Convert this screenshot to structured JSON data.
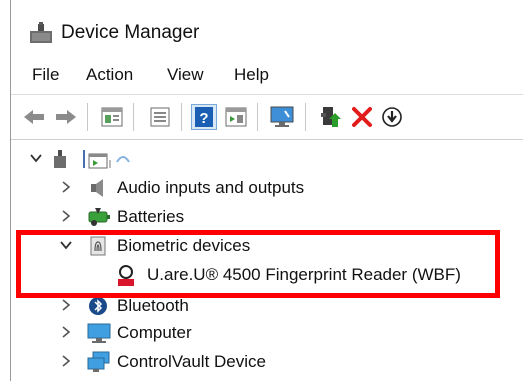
{
  "window": {
    "title": "Device Manager"
  },
  "menu": {
    "items": [
      "File",
      "Action",
      "View",
      "Help"
    ]
  },
  "toolbar": {
    "icons": [
      "back-arrow-icon",
      "forward-arrow-icon",
      "properties-pane-icon",
      "list-view-icon",
      "help-icon",
      "driver-details-icon",
      "scan-monitor-icon",
      "update-driver-icon",
      "uninstall-icon",
      "download-icon"
    ]
  },
  "tree": {
    "root": {
      "label": ""
    },
    "nodes": [
      {
        "label": "Audio inputs and outputs",
        "expanded": false
      },
      {
        "label": "Batteries",
        "expanded": false
      },
      {
        "label": "Biometric devices",
        "expanded": true,
        "children": [
          {
            "label": "U.are.U® 4500 Fingerprint Reader (WBF)"
          }
        ]
      },
      {
        "label": "Bluetooth",
        "expanded": false
      },
      {
        "label": "Computer",
        "expanded": false
      },
      {
        "label": "ControlVault Device",
        "expanded": false
      }
    ]
  },
  "colors": {
    "highlight": "#ff0000",
    "accent": "#1a5fb4",
    "uninstall": "#e21b1b",
    "update": "#2a9d2a"
  }
}
